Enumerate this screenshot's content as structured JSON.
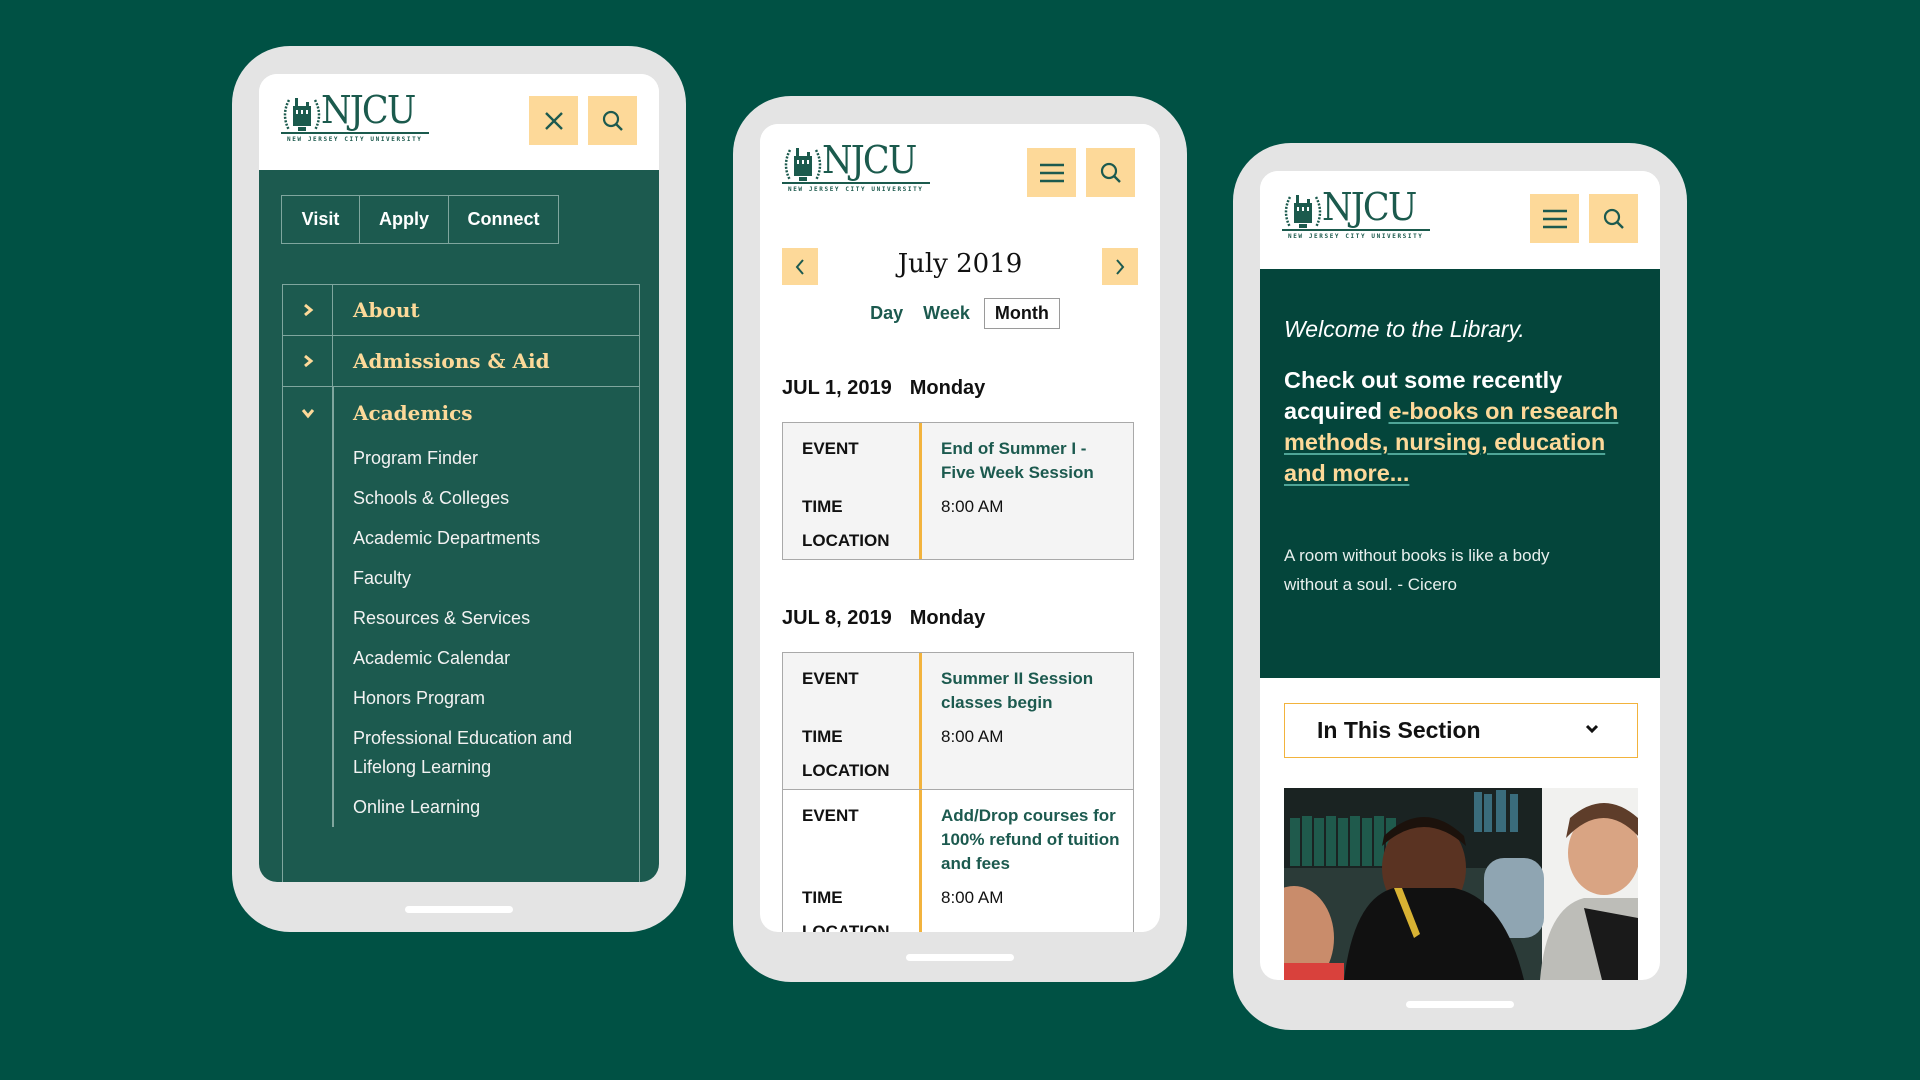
{
  "brand": {
    "wordmark": "NJCU",
    "tagline": "NEW JERSEY CITY UNIVERSITY",
    "colors": {
      "background": "#005144",
      "primary_green": "#1c5a4f",
      "dark_green": "#04453b",
      "accent_yellow": "#fdd999",
      "accent_orange": "#f2b33d"
    }
  },
  "phone_menu": {
    "header": {
      "close_icon": "close-icon",
      "search_icon": "search-icon"
    },
    "quick_links": [
      "Visit",
      "Apply",
      "Connect"
    ],
    "menu": [
      {
        "label": "About",
        "icon": "chevron-right-icon",
        "expanded": false
      },
      {
        "label": "Admissions & Aid",
        "icon": "chevron-right-icon",
        "expanded": false
      },
      {
        "label": "Academics",
        "icon": "chevron-down-icon",
        "expanded": true,
        "children": [
          "Program Finder",
          "Schools & Colleges",
          "Academic Departments",
          "Faculty",
          "Resources & Services",
          "Academic Calendar",
          "Honors Program",
          "Professional Education and Lifelong Learning",
          "Online Learning"
        ]
      }
    ]
  },
  "phone_calendar": {
    "header": {
      "menu_icon": "hamburger-icon",
      "search_icon": "search-icon"
    },
    "month_title": "July 2019",
    "prev_icon": "chevron-left-icon",
    "next_icon": "chevron-right-icon",
    "views": [
      "Day",
      "Week",
      "Month"
    ],
    "active_view": "Month",
    "labels": {
      "event": "EVENT",
      "time": "TIME",
      "location": "LOCATION"
    },
    "days": [
      {
        "date": "JUL 1, 2019",
        "weekday": "Monday",
        "events": [
          {
            "title": "End of Summer I - Five Week Session",
            "time": "8:00 AM",
            "location": ""
          }
        ]
      },
      {
        "date": "JUL 8, 2019",
        "weekday": "Monday",
        "events": [
          {
            "title": "Summer II Session classes begin",
            "time": "8:00 AM",
            "location": ""
          },
          {
            "title": "Add/Drop courses for 100% refund of tuition and fees",
            "time": "8:00 AM",
            "location": ""
          }
        ]
      }
    ]
  },
  "phone_library": {
    "header": {
      "menu_icon": "hamburger-icon",
      "search_icon": "search-icon"
    },
    "welcome": "Welcome to the Library.",
    "intro_prefix": "Check out some recently acquired ",
    "intro_link": "e-books on research methods, nursing, education and more... ",
    "quote": "A room without books is like a body without a soul. - Cicero",
    "section_dropdown": "In This Section",
    "photo_alt": "students smiling in library"
  }
}
